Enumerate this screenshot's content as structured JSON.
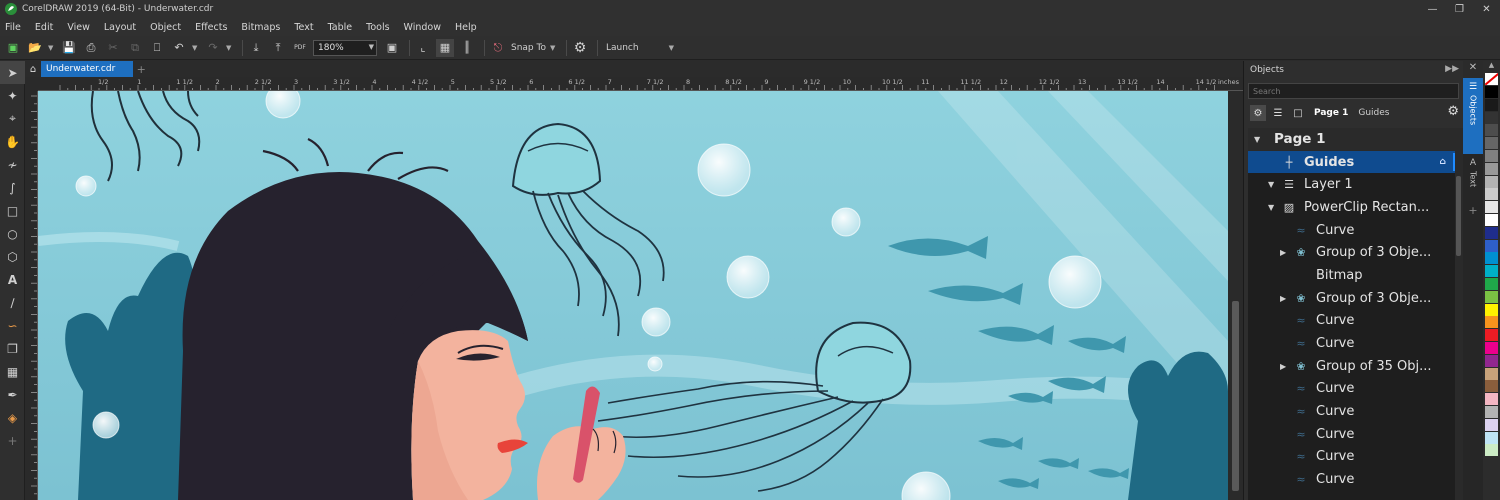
{
  "window": {
    "title": "CorelDRAW 2019 (64-Bit) - Underwater.cdr"
  },
  "menu": [
    "File",
    "Edit",
    "View",
    "Layout",
    "Object",
    "Effects",
    "Bitmaps",
    "Text",
    "Table",
    "Tools",
    "Window",
    "Help"
  ],
  "toolbar": {
    "zoom": "180%",
    "snap_to": "Snap To",
    "launch": "Launch",
    "pdf_label": "PDF"
  },
  "document_tab": "Underwater.cdr",
  "ruler": {
    "unit": "inches",
    "labels": [
      "1/2",
      "1",
      "1 1/2",
      "2",
      "2 1/2",
      "3",
      "3 1/2",
      "4",
      "4 1/2",
      "5",
      "5 1/2",
      "6",
      "6 1/2",
      "7",
      "7 1/2",
      "8",
      "8 1/2",
      "9",
      "9 1/2",
      "10",
      "10 1/2",
      "11",
      "11 1/2",
      "12",
      "12 1/2",
      "13",
      "13 1/2",
      "14",
      "14 1/2"
    ]
  },
  "docker": {
    "title": "Objects",
    "search_placeholder": "Search",
    "page_label": "Page 1",
    "guides_label": "Guides",
    "tree": [
      {
        "label": "Page 1",
        "type": "page",
        "level": 0,
        "arrow": "down"
      },
      {
        "label": "Guides",
        "type": "guides",
        "level": 1,
        "arrow": ""
      },
      {
        "label": "Layer 1",
        "type": "layer",
        "level": 1,
        "arrow": "down"
      },
      {
        "label": "PowerClip Rectan...",
        "type": "powerclip",
        "level": 2,
        "arrow": "down"
      },
      {
        "label": "Curve",
        "type": "curve",
        "level": 3,
        "arrow": ""
      },
      {
        "label": "Group of 3 Obje...",
        "type": "group",
        "level": 3,
        "arrow": "right"
      },
      {
        "label": "Bitmap",
        "type": "bitmap",
        "level": 3,
        "arrow": ""
      },
      {
        "label": "Group of 3 Obje...",
        "type": "group",
        "level": 3,
        "arrow": "right"
      },
      {
        "label": "Curve",
        "type": "curve",
        "level": 3,
        "arrow": ""
      },
      {
        "label": "Curve",
        "type": "curve",
        "level": 3,
        "arrow": ""
      },
      {
        "label": "Group of 35 Obj...",
        "type": "group",
        "level": 3,
        "arrow": "right"
      },
      {
        "label": "Curve",
        "type": "curve",
        "level": 3,
        "arrow": ""
      },
      {
        "label": "Curve",
        "type": "curve",
        "level": 3,
        "arrow": ""
      },
      {
        "label": "Curve",
        "type": "curve",
        "level": 3,
        "arrow": ""
      },
      {
        "label": "Curve",
        "type": "curve",
        "level": 3,
        "arrow": ""
      },
      {
        "label": "Curve",
        "type": "curve",
        "level": 3,
        "arrow": ""
      }
    ]
  },
  "side_tabs": {
    "objects": "Objects",
    "text": "Text"
  },
  "palette": [
    "#000000",
    "#1a1a1a",
    "#333333",
    "#4d4d4d",
    "#666666",
    "#808080",
    "#999999",
    "#b3b3b3",
    "#cccccc",
    "#e6e6e6",
    "#ffffff",
    "#1f2d8c",
    "#2e5fc9",
    "#0090d0",
    "#00b0c8",
    "#1fa84a",
    "#7ac143",
    "#fff200",
    "#f7941d",
    "#ed1c24",
    "#ec008c",
    "#92278f",
    "#c8a27a",
    "#8b5e3c",
    "#f4b6c2",
    "#b3b3b3",
    "#dcd3f0",
    "#bfe4f5",
    "#ccebc5"
  ],
  "colors": {
    "accent": "#1e6fc0",
    "selection": "#0f4b8f",
    "water": "#8fd0dc",
    "hair": "#26222e",
    "skin": "#f3b39e"
  }
}
